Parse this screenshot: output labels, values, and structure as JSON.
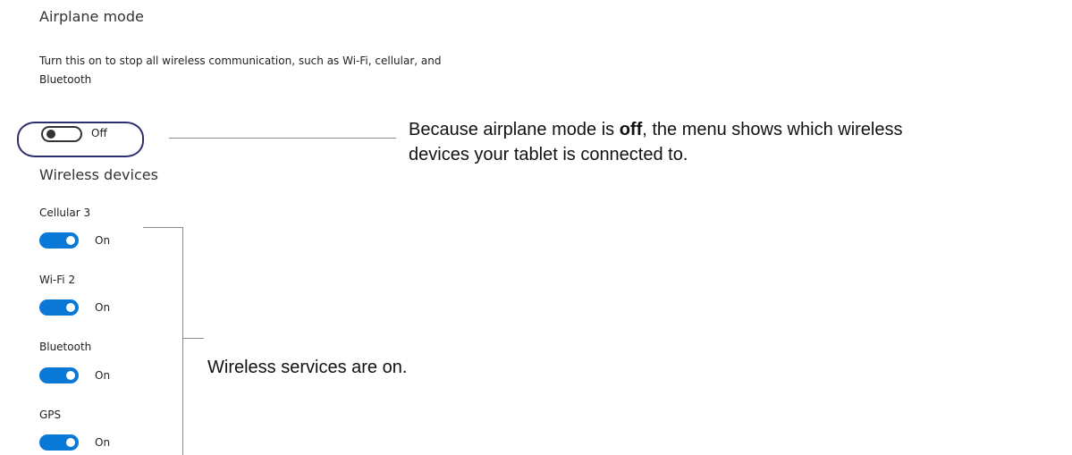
{
  "airplane_mode": {
    "title": "Airplane mode",
    "description": "Turn this on to stop all wireless communication, such as Wi-Fi, cellular, and Bluetooth",
    "toggle_state": "Off",
    "value": false
  },
  "wireless_devices": {
    "title": "Wireless devices",
    "items": [
      {
        "label": "Cellular 3",
        "state": "On",
        "value": true
      },
      {
        "label": "Wi-Fi 2",
        "state": "On",
        "value": true
      },
      {
        "label": "Bluetooth",
        "state": "On",
        "value": true
      },
      {
        "label": "GPS",
        "state": "On",
        "value": true
      }
    ]
  },
  "annotations": {
    "airplane_prefix": "Because airplane mode is ",
    "airplane_bold": "off",
    "airplane_line1_suffix": ", the menu shows which wireless",
    "airplane_line2": "devices your tablet is connected to.",
    "wireless_note": "Wireless services are on."
  },
  "colors": {
    "toggle_on": "#0a78d7",
    "highlight_ring": "#2d2e6d",
    "connector_line": "#8a8a8a"
  }
}
